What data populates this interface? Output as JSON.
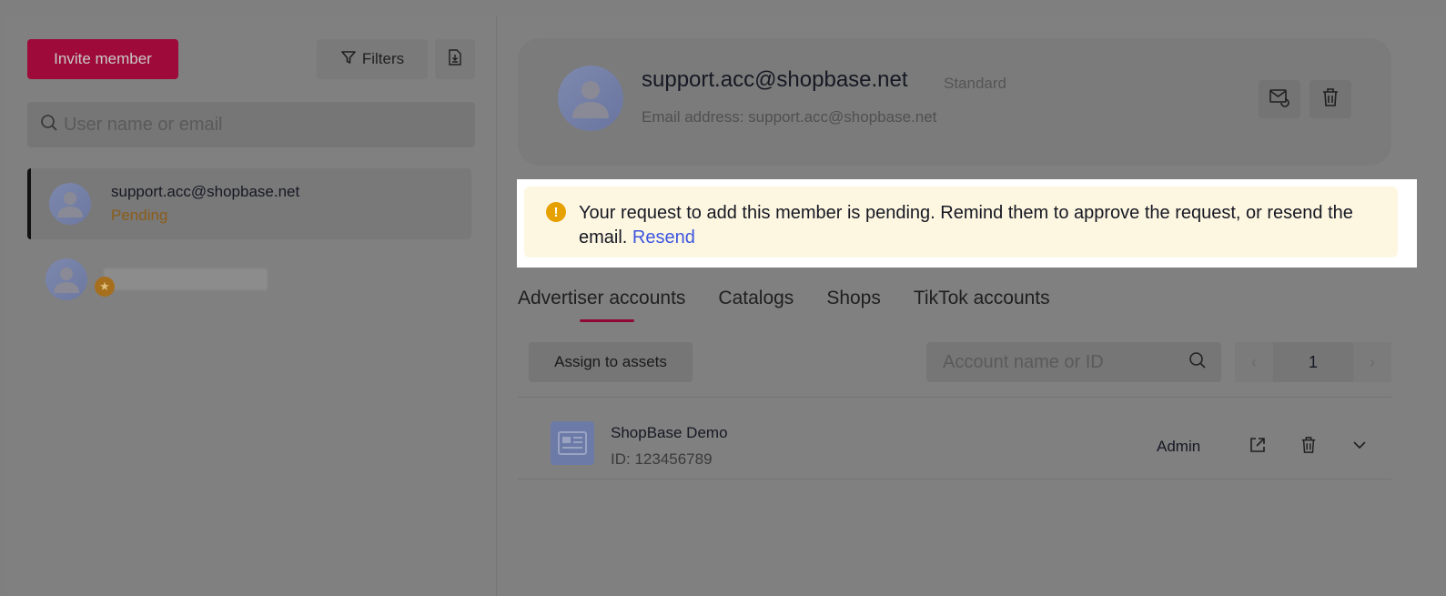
{
  "sidebar": {
    "invite_label": "Invite member",
    "filters_label": "Filters",
    "search_placeholder": "User name or email",
    "members": [
      {
        "name": "support.acc@shopbase.net",
        "status": "Pending"
      }
    ]
  },
  "profile": {
    "email": "support.acc@shopbase.net",
    "role": "Standard",
    "email_line": "Email address: support.acc@shopbase.net"
  },
  "notice": {
    "text": "Your request to add this member is pending. Remind them to approve the request, or resend the email. ",
    "link": "Resend"
  },
  "tabs": [
    {
      "label": "Advertiser accounts"
    },
    {
      "label": "Catalogs"
    },
    {
      "label": "Shops"
    },
    {
      "label": "TikTok accounts"
    }
  ],
  "assets": {
    "assign_label": "Assign to assets",
    "search_placeholder": "Account name or ID",
    "page": "1",
    "rows": [
      {
        "name": "ShopBase Demo",
        "id": "ID: 123456789",
        "role": "Admin"
      }
    ]
  },
  "colors": {
    "accent": "#fe2c55",
    "pending": "#e8901d",
    "link": "#3d55e0",
    "notice_bg": "#fdf7e1"
  }
}
